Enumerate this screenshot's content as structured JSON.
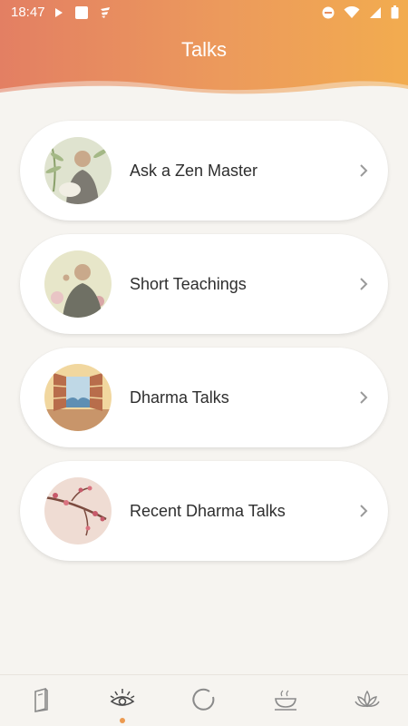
{
  "status_bar": {
    "time": "18:47",
    "left_icons": [
      "play-icon",
      "square-icon",
      "app-notification-icon"
    ],
    "right_icons": [
      "do-not-disturb-icon",
      "wifi-icon",
      "cellular-signal-icon",
      "battery-icon"
    ]
  },
  "header": {
    "title": "Talks",
    "gradient": [
      "#e37f63",
      "#f2ac4f"
    ]
  },
  "cards": [
    {
      "label": "Ask a Zen Master",
      "thumb": "monk-bamboo-illustration"
    },
    {
      "label": "Short Teachings",
      "thumb": "monk-teaching-illustration"
    },
    {
      "label": "Dharma Talks",
      "thumb": "open-window-sea-illustration"
    },
    {
      "label": "Recent Dharma Talks",
      "thumb": "cherry-blossom-branch-illustration"
    }
  ],
  "bottom_nav": {
    "items": [
      {
        "icon": "book-icon",
        "active": false
      },
      {
        "icon": "eye-sun-icon",
        "active": true
      },
      {
        "icon": "circle-enso-icon",
        "active": false
      },
      {
        "icon": "tea-cup-icon",
        "active": false
      },
      {
        "icon": "lotus-icon",
        "active": false
      }
    ],
    "active_color": "#ec9a50"
  }
}
